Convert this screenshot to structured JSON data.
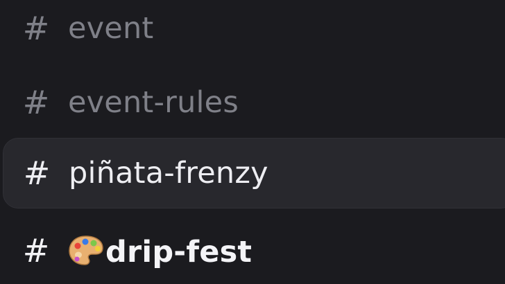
{
  "channels": [
    {
      "prefix": "#",
      "name": "event",
      "state": "muted"
    },
    {
      "prefix": "#",
      "name": "event-rules",
      "state": "muted"
    },
    {
      "prefix": "#",
      "name": "piñata-frenzy",
      "state": "active"
    },
    {
      "prefix": "#",
      "emoji": "palette-emoji",
      "name": "drip-fest",
      "state": "unread"
    }
  ],
  "colors": {
    "background": "#1b1b1f",
    "active_row": "#28282d",
    "muted_text": "#7f8088",
    "bright_text": "#eeeef2"
  }
}
